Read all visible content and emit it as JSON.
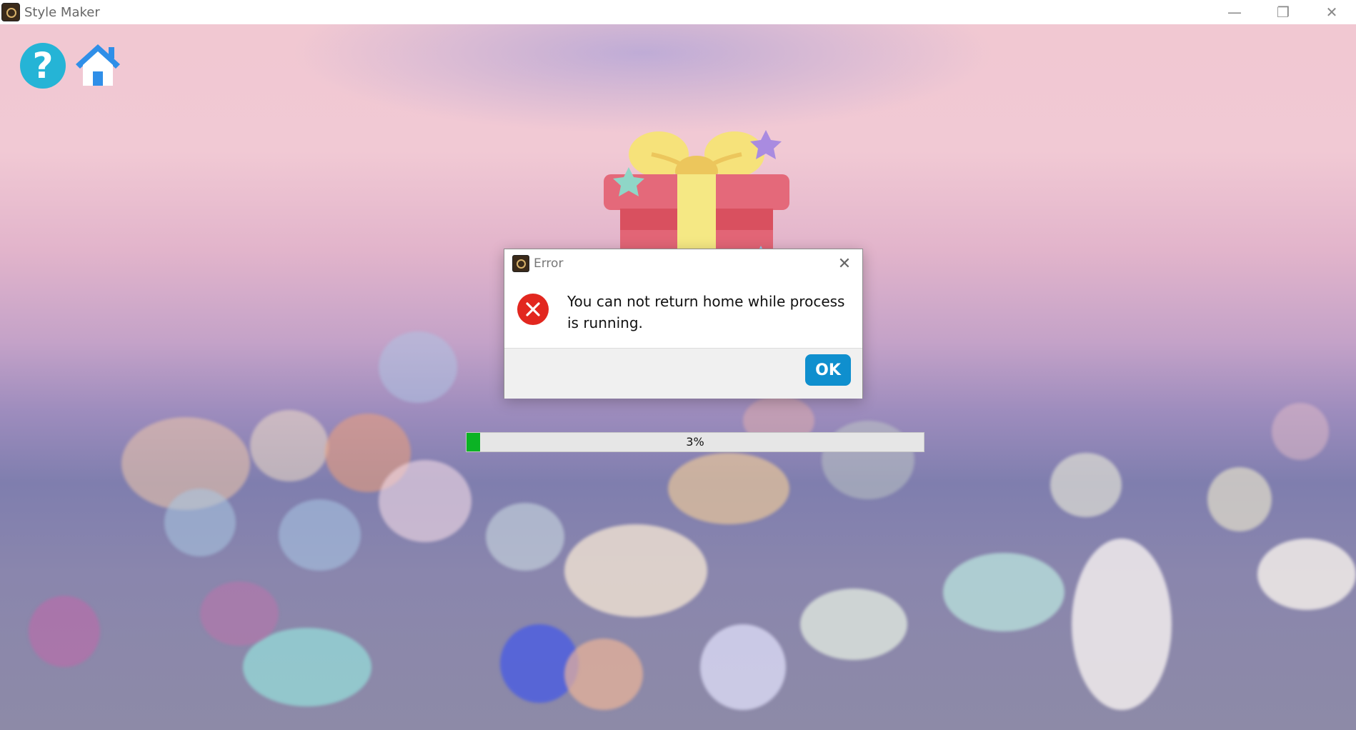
{
  "window": {
    "title": "Style Maker",
    "app_icon": "camera-icon",
    "controls": {
      "minimize": "—",
      "restore": "❐",
      "close": "✕"
    }
  },
  "toolbar": {
    "help_label": "?",
    "help_icon": "help-icon",
    "home_icon": "home-icon"
  },
  "hero": {
    "icon": "gift-icon"
  },
  "progress": {
    "value": 0.03,
    "label": "3%",
    "color": "#0bb324"
  },
  "dialog": {
    "title": "Error",
    "icon": "error-icon",
    "close": "✕",
    "message": "You can not return home while process is running.",
    "ok_label": "OK"
  },
  "colors": {
    "help": "#25b4d6",
    "home": "#2f8fe8",
    "ok_button": "#0f8fce",
    "error": "#e2271f"
  }
}
